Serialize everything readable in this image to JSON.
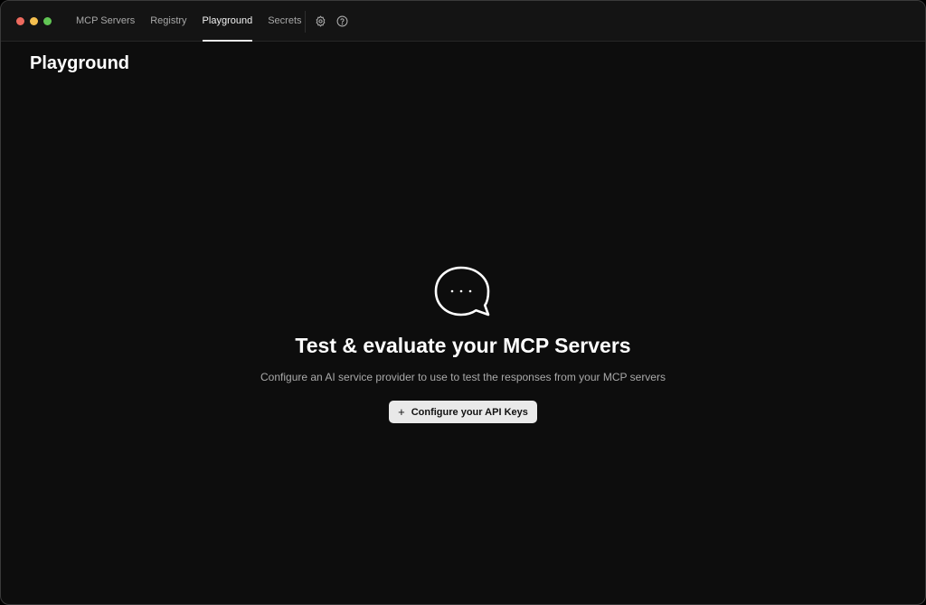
{
  "nav": {
    "tabs": [
      {
        "label": "MCP Servers",
        "active": false
      },
      {
        "label": "Registry",
        "active": false
      },
      {
        "label": "Playground",
        "active": true
      },
      {
        "label": "Secrets",
        "active": false
      }
    ],
    "icons": [
      "gear-icon",
      "help-icon"
    ]
  },
  "page": {
    "title": "Playground"
  },
  "empty_state": {
    "icon": "chat-bubble-icon",
    "heading": "Test & evaluate your MCP Servers",
    "description": "Configure an AI service provider to use to test the responses from your MCP servers",
    "cta_icon": "plus-icon",
    "cta_label": "Configure your API Keys",
    "cta_plus": "+"
  },
  "colors": {
    "background": "#0d0d0d",
    "titlebar": "#141414",
    "button_bg": "#e9e9e9",
    "close": "#ed6a5e",
    "minimize": "#f5bf4f",
    "maximize": "#61c554"
  }
}
